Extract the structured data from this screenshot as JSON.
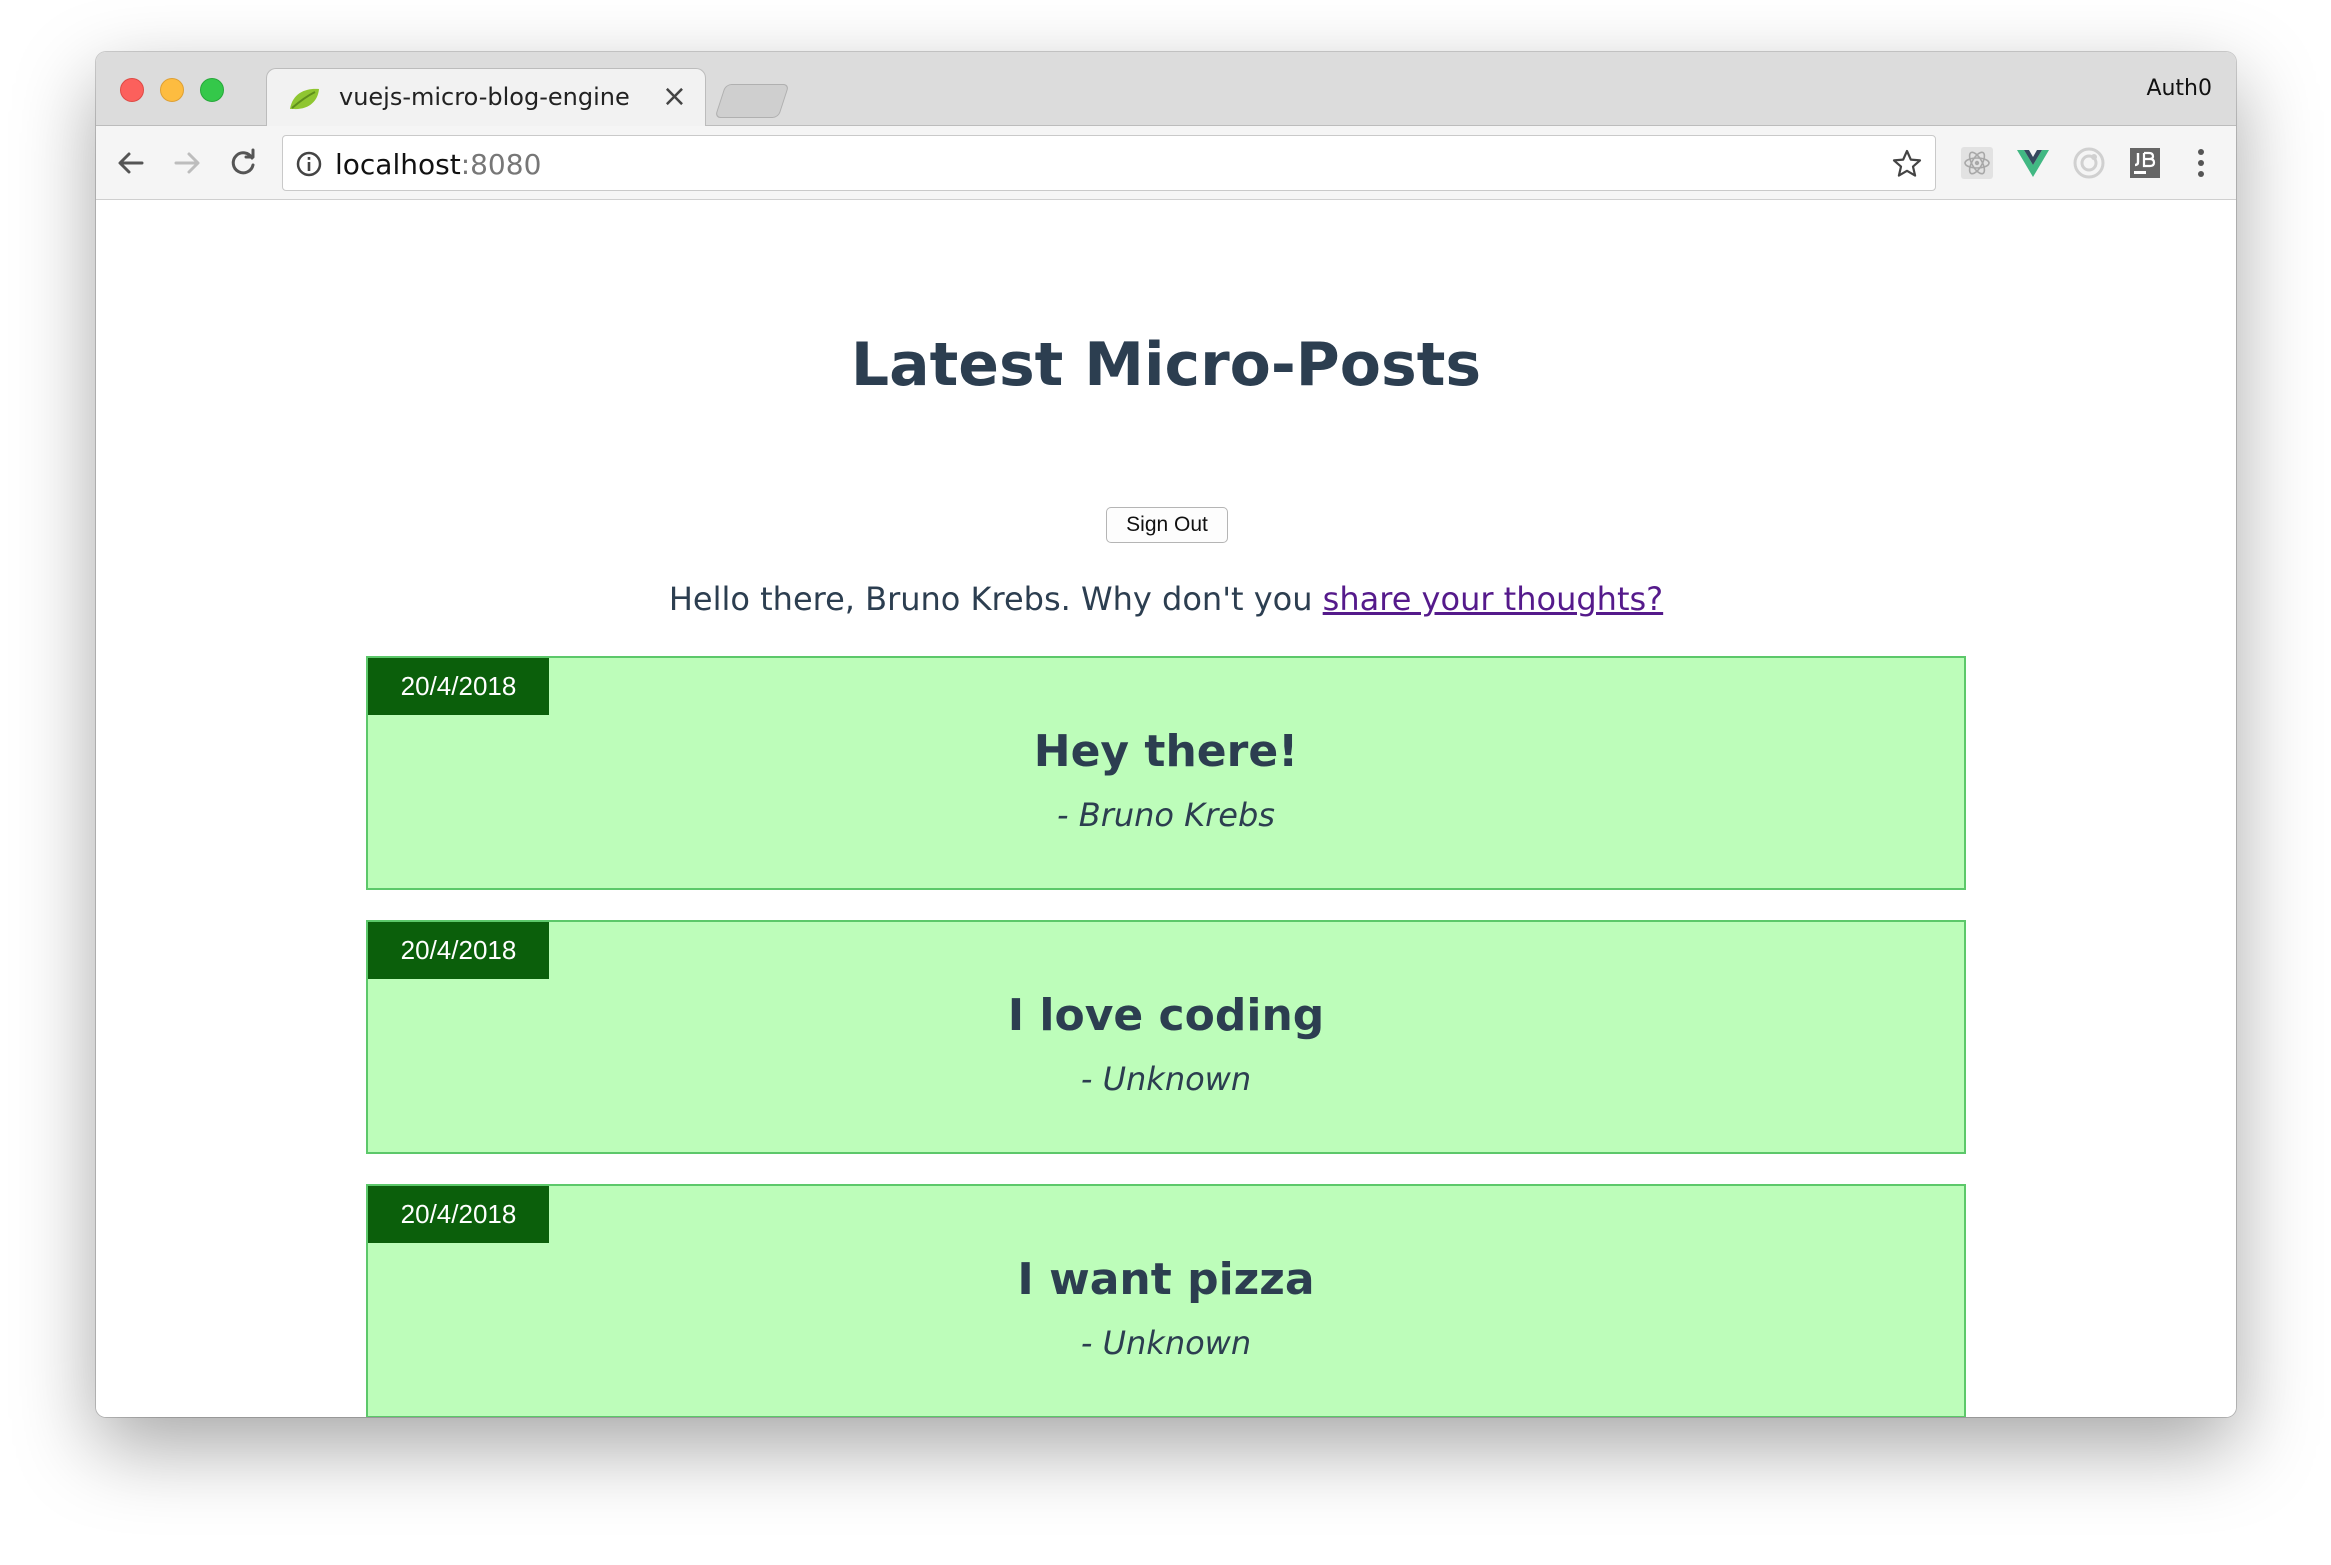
{
  "browser": {
    "tab_title": "vuejs-micro-blog-engine",
    "tab_close": "×",
    "profile_name": "Auth0",
    "url_host": "localhost",
    "url_port": ":8080",
    "icons": [
      "back-arrow-icon",
      "forward-arrow-icon",
      "reload-icon",
      "info-icon",
      "star-icon",
      "react-devtools-icon",
      "vue-devtools-icon",
      "extension-circle-icon",
      "jetbrains-icon",
      "more-menu-icon"
    ]
  },
  "page": {
    "title": "Latest Micro-Posts",
    "signout_label": "Sign Out",
    "greeting_prefix": "Hello there, Bruno Krebs. Why don't you ",
    "greeting_link": "share your thoughts?",
    "link_color": "#551a8b"
  },
  "posts": [
    {
      "date": "20/4/2018",
      "title": "Hey there!",
      "author": "- Bruno Krebs"
    },
    {
      "date": "20/4/2018",
      "title": "I love coding",
      "author": "- Unknown"
    },
    {
      "date": "20/4/2018",
      "title": "I want pizza",
      "author": "- Unknown"
    }
  ],
  "colors": {
    "post_bg": "#bdfdba",
    "post_border": "#5cc86a",
    "date_bg": "#0b5f0b",
    "text": "#2c3e50"
  }
}
